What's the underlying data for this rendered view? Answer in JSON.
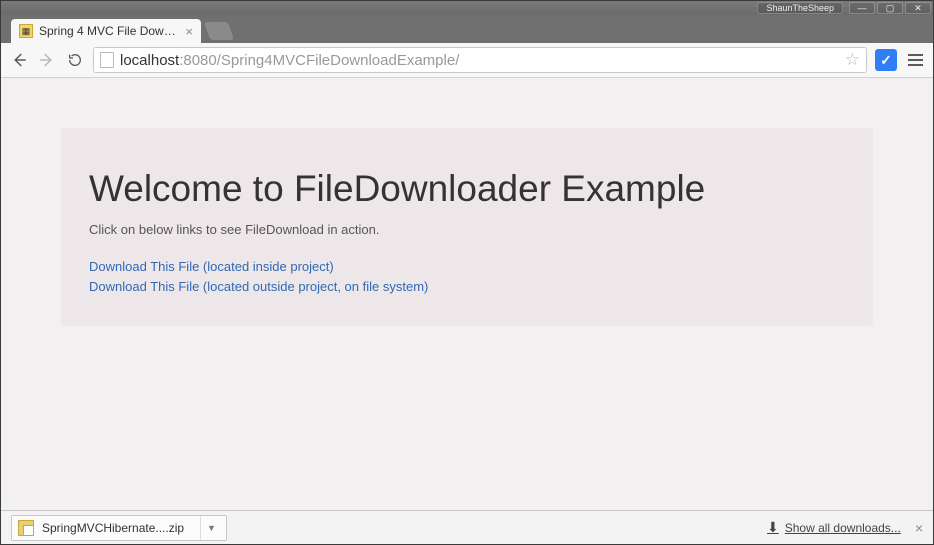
{
  "os": {
    "user": "ShaunTheSheep"
  },
  "browser": {
    "tab_title": "Spring 4 MVC File Downlo",
    "url_host": "localhost",
    "url_port": ":8080",
    "url_path": "/Spring4MVCFileDownloadExample/"
  },
  "page": {
    "heading": "Welcome to FileDownloader Example",
    "subtext": "Click on below links to see FileDownload in action.",
    "link_internal": "Download This File (located inside project)",
    "link_external": "Download This File (located outside project, on file system)"
  },
  "downloads": {
    "item_name": "SpringMVCHibernate....zip",
    "show_all_label": "Show all downloads..."
  }
}
